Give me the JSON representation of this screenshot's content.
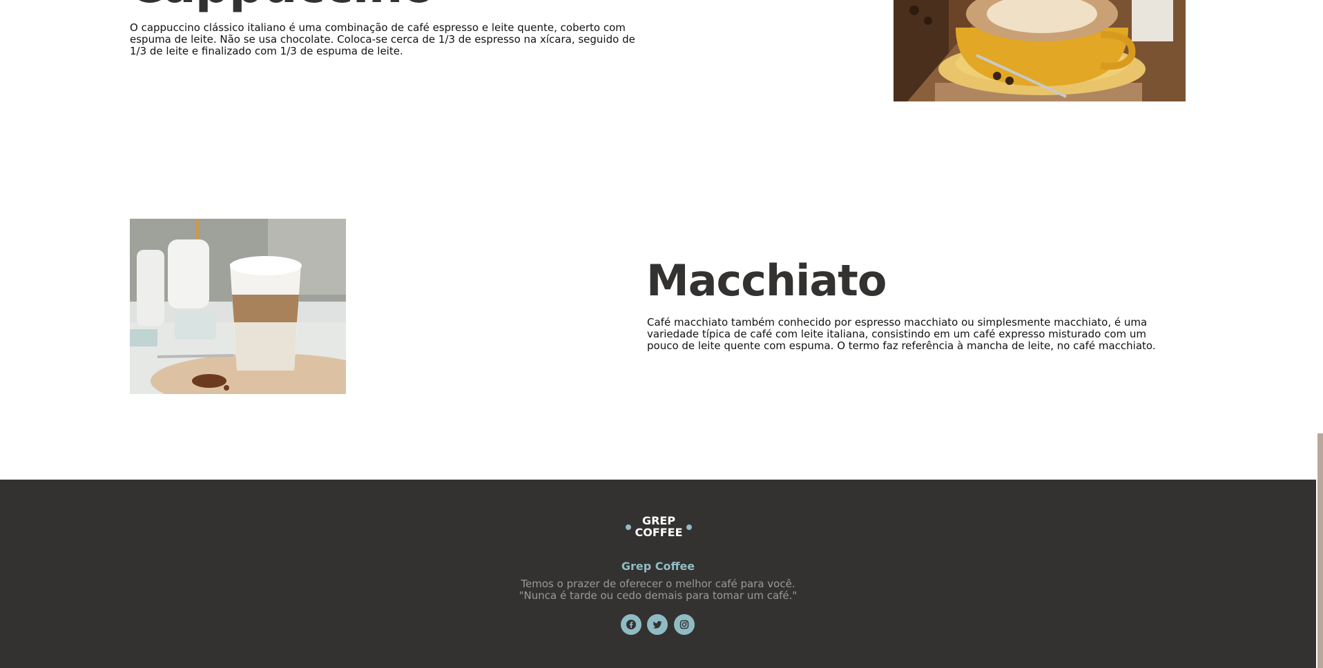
{
  "cappuccino": {
    "title": "Cappuccino",
    "description": "O cappuccino clássico italiano é uma combinação de café espresso e leite quente, coberto com espuma de leite. Não se usa chocolate. Coloca-se cerca de 1/3 de espresso na xícara, seguido de 1/3 de leite e finalizado com 1/3 de espuma de leite."
  },
  "macchiato": {
    "title": "Macchiato",
    "description": "Café macchiato também conhecido por espresso macchiato ou simplesmente macchiato, é uma variedade típica de café com leite italiana, consistindo em um café expresso misturado com um pouco de leite quente com espuma. O termo faz referência à mancha de leite, no café macchiato."
  },
  "footer": {
    "logo_line1": "GREP",
    "logo_line2": "COFFEE",
    "brand_name": "Grep Coffee",
    "tagline_line1": "Temos o prazer de oferecer o melhor café para você.",
    "tagline_line2": "\"Nunca é tarde ou cedo demais para tomar um café.\"",
    "social_icons": [
      "facebook-icon",
      "twitter-icon",
      "instagram-icon"
    ]
  },
  "colors": {
    "footer_bg": "#333230",
    "accent": "#8fbcc4",
    "heading": "#333230",
    "tagline": "#9c9a96",
    "scrollbar_thumb": "#b8a79b"
  }
}
